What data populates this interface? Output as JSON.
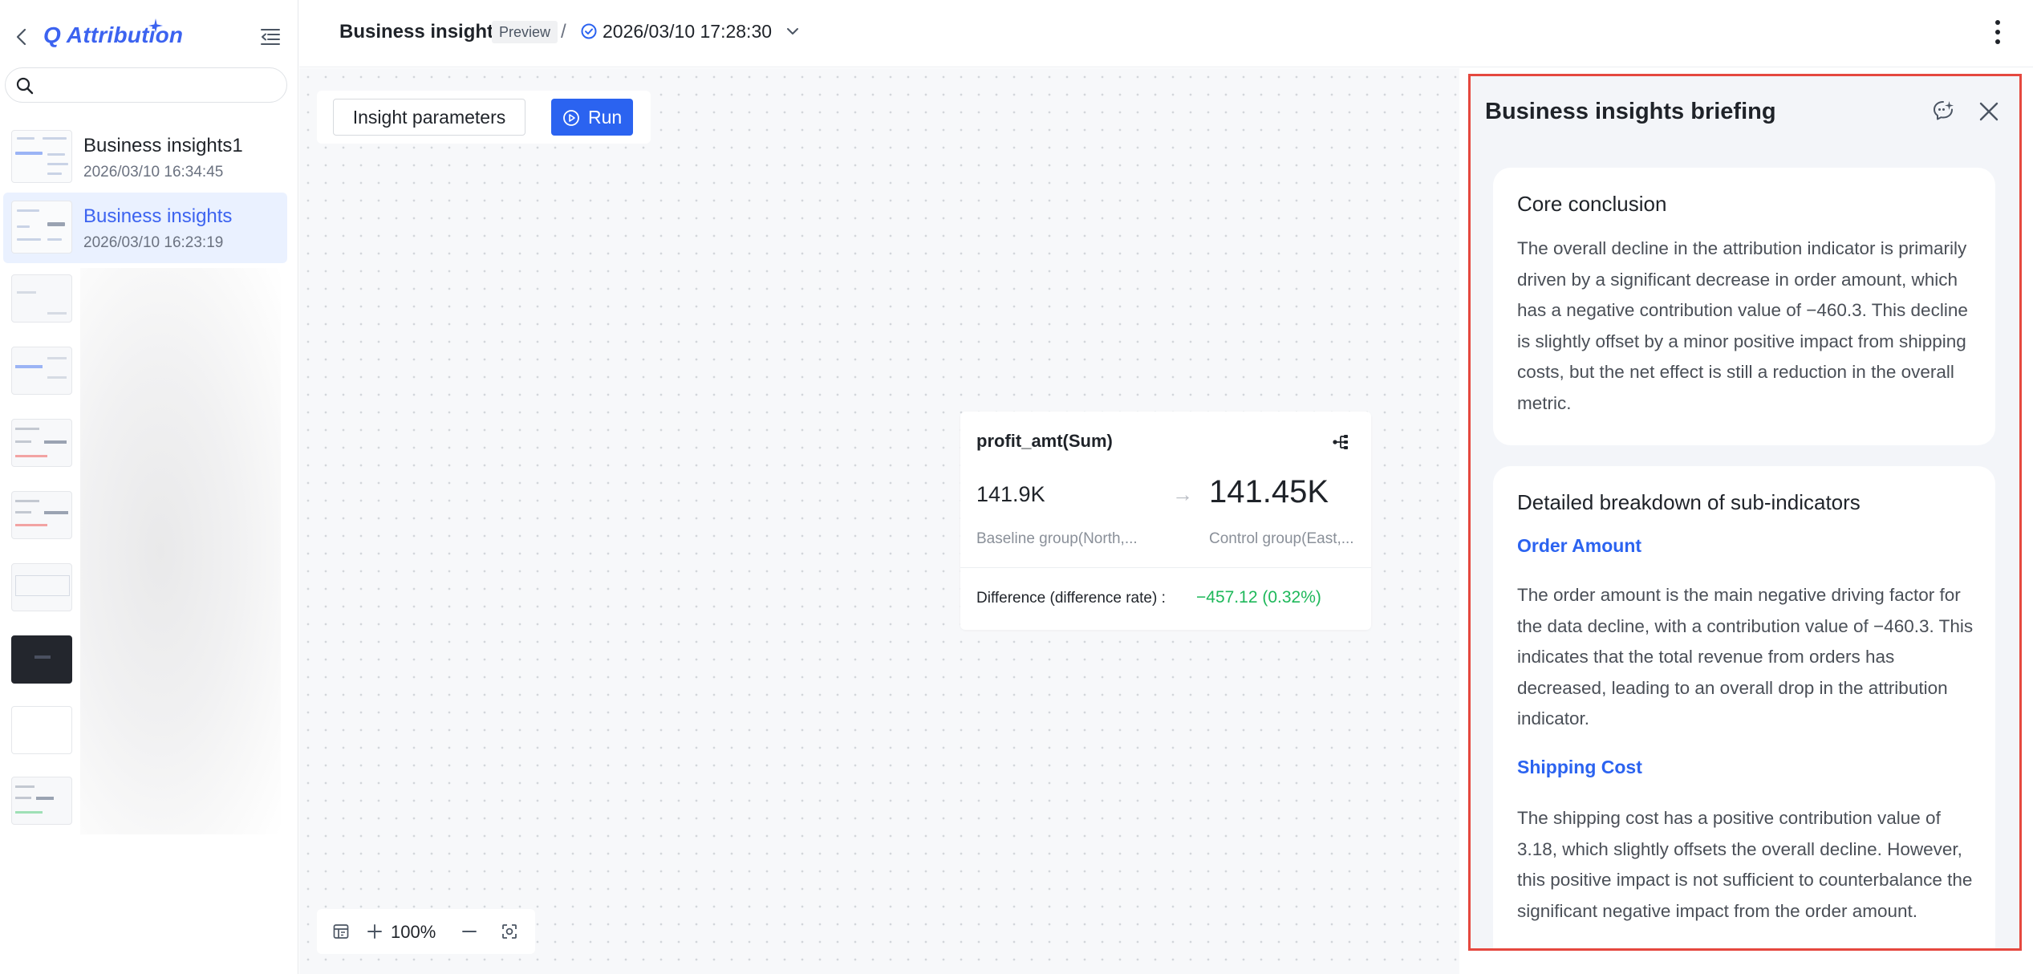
{
  "app": {
    "title": "Q Attribution"
  },
  "search": {
    "placeholder": "",
    "value": ""
  },
  "history": [
    {
      "name": "Business insights1",
      "time": "2026/03/10 16:34:45"
    },
    {
      "name": "Business insights",
      "time": "2026/03/10 16:23:19"
    }
  ],
  "header": {
    "title": "Business insights",
    "badge": "Preview",
    "separator": "/",
    "version": "2026/03/10 17:28:30"
  },
  "canvas": {
    "params_label": "Insight parameters",
    "run_label": "Run",
    "zoom": "100%"
  },
  "metric_card": {
    "title": "profit_amt(Sum)",
    "baseline_value": "141.9K",
    "arrow": "→",
    "control_value": "141.45K",
    "baseline_label": "Baseline group(North,...",
    "control_label": "Control group(East,...",
    "difference_label": "Difference (difference rate) :",
    "difference_value": "−457.12 (0.32%)",
    "difference_color": "#1eb85a"
  },
  "panel": {
    "title": "Business insights briefing",
    "core": {
      "heading": "Core conclusion",
      "text": "The overall decline in the attribution indicator is primarily driven by a significant decrease in order amount, which has a negative contribution value of −460.3. This decline is slightly offset by a minor positive impact from shipping costs, but the net effect is still a reduction in the overall metric."
    },
    "breakdown": {
      "heading": "Detailed breakdown of sub-indicators",
      "items": [
        {
          "title": "Order Amount",
          "text": "The order amount is the main negative driving factor for the data decline, with a contribution value of −460.3. This indicates that the total revenue from orders has decreased, leading to an overall drop in the attribution indicator."
        },
        {
          "title": "Shipping Cost",
          "text": "The shipping cost has a positive contribution value of 3.18, which slightly offsets the overall decline. However, this positive impact is not sufficient to counterbalance the significant negative impact from the order amount."
        }
      ]
    }
  },
  "colors": {
    "accent": "#2b63f0",
    "brand": "#3c63f0",
    "highlight_border": "#e5483f",
    "positive": "#1eb85a"
  },
  "icons": [
    "back-icon",
    "sparkle-icon",
    "collapse-sidebar-icon",
    "search-icon",
    "check-circle-icon",
    "chevron-down-icon",
    "more-vertical-icon",
    "play-circle-icon",
    "tree-icon",
    "table-icon",
    "plus-icon",
    "minus-icon",
    "fit-screen-icon",
    "ai-assistant-icon",
    "close-icon"
  ]
}
